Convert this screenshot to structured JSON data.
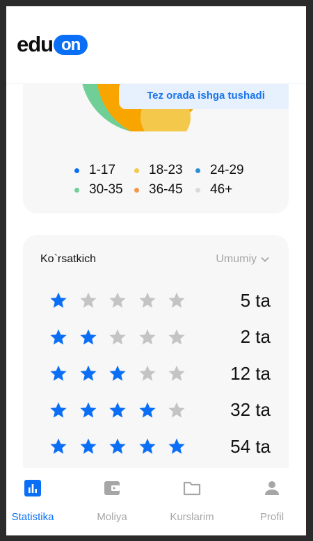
{
  "app": {
    "logo_text": "edu",
    "logo_pill_text": "on",
    "brand_color": "#0b6ff5"
  },
  "age_chart": {
    "toast": "Tez orada ishga tushadi",
    "legend": [
      {
        "label": "1-17",
        "color": "#0b6ff5"
      },
      {
        "label": "18-23",
        "color": "#f4c84a"
      },
      {
        "label": "24-29",
        "color": "#2b8fd6"
      },
      {
        "label": "30-35",
        "color": "#6fcf97"
      },
      {
        "label": "36-45",
        "color": "#f2994a"
      },
      {
        "label": "46+",
        "color": "#d9d9d9"
      }
    ]
  },
  "ratings": {
    "title": "Ko`rsatkich",
    "filter": "Umumiy",
    "rows": [
      {
        "stars": 1,
        "count": "5 ta"
      },
      {
        "stars": 2,
        "count": "2 ta"
      },
      {
        "stars": 3,
        "count": "12 ta"
      },
      {
        "stars": 4,
        "count": "32 ta"
      },
      {
        "stars": 5,
        "count": "54 ta"
      }
    ],
    "star_on_color": "#0b6ff5",
    "star_off_color": "#c4c4c4"
  },
  "nav": [
    {
      "label": "Statistika",
      "icon": "bar-chart-icon",
      "active": true
    },
    {
      "label": "Moliya",
      "icon": "wallet-icon",
      "active": false
    },
    {
      "label": "Kurslarim",
      "icon": "folder-icon",
      "active": false
    },
    {
      "label": "Profil",
      "icon": "person-icon",
      "active": false
    }
  ]
}
